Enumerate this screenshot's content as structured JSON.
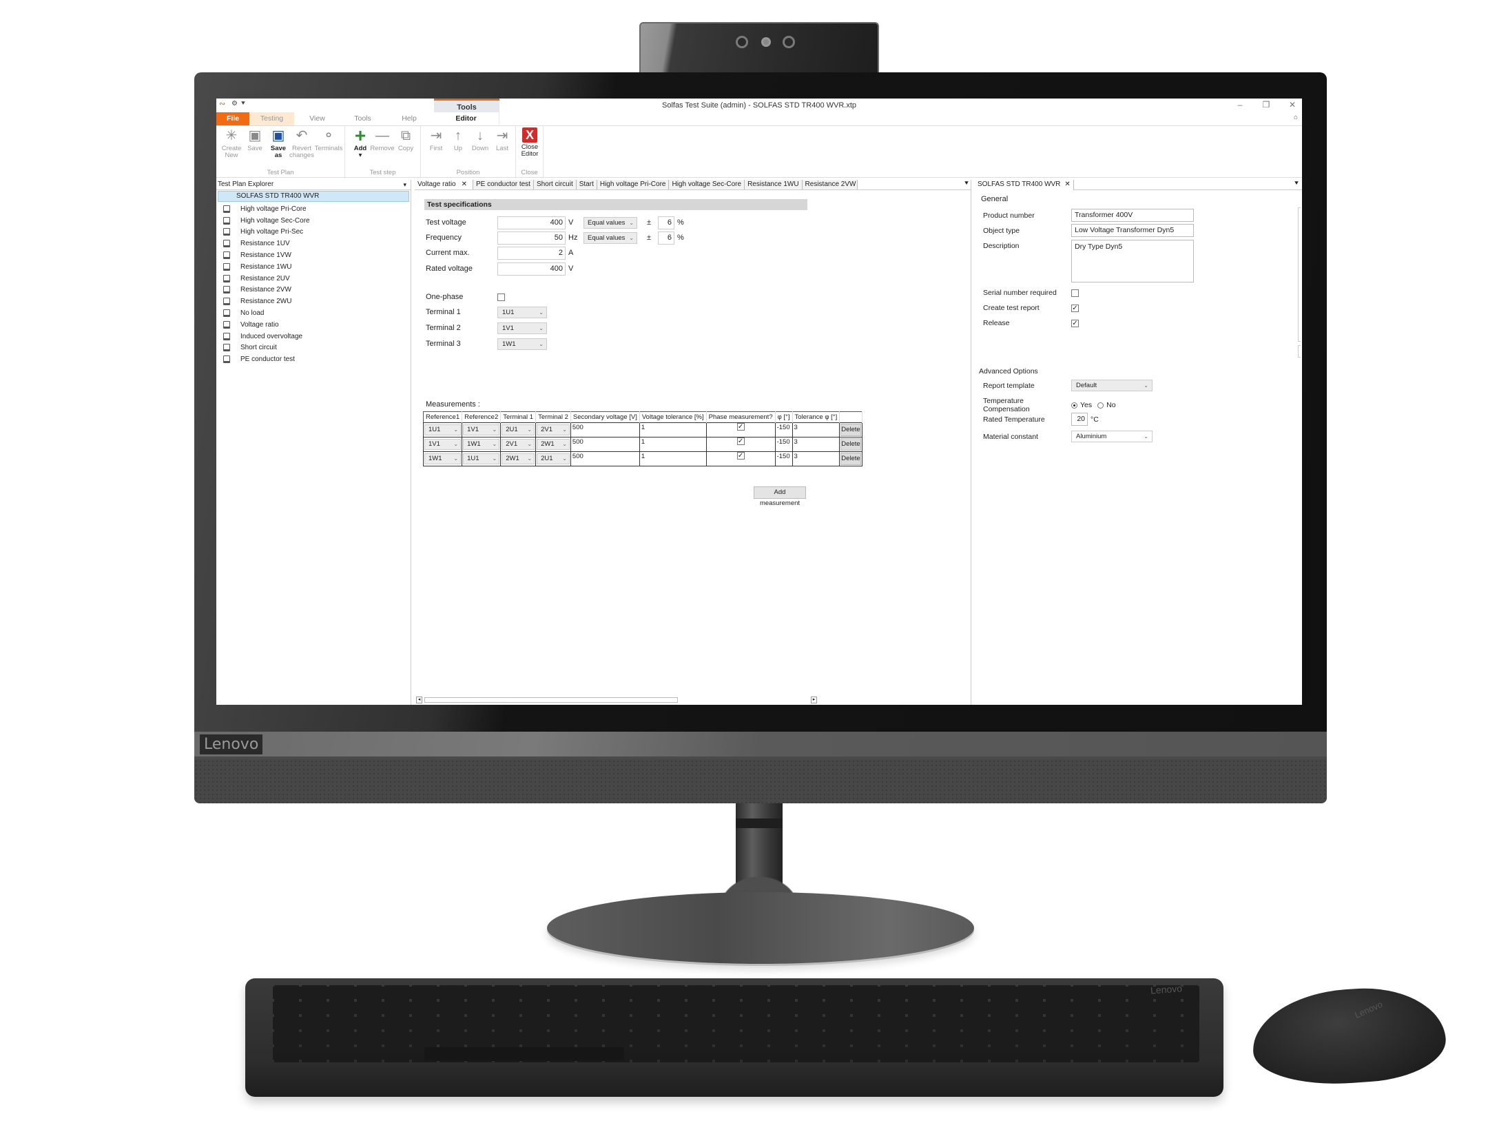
{
  "app": {
    "title": "Solfas Test Suite (admin)  - SOLFAS STD TR400 WVR.xtp",
    "accent_color": "#f26b12",
    "window_controls": {
      "minimize": "–",
      "restore": "❐",
      "close": "✕"
    },
    "collapse_ribbon": "⌂"
  },
  "ribbon": {
    "contextual_group": "Tools",
    "tabs": [
      {
        "label": "File"
      },
      {
        "label": "Testing"
      },
      {
        "label": "View"
      },
      {
        "label": "Tools"
      },
      {
        "label": "Help"
      },
      {
        "label": "Editor"
      }
    ],
    "groups": {
      "test_plan": {
        "label": "Test Plan",
        "buttons": [
          {
            "label": "Create",
            "label2": "New",
            "icon": "✳"
          },
          {
            "label": "Save",
            "label2": "",
            "icon": "💾"
          },
          {
            "label": "Save",
            "label2": "as",
            "icon": "🖉"
          },
          {
            "label": "Revert",
            "label2": "changes",
            "icon": "↶"
          },
          {
            "label": "Terminals",
            "label2": "",
            "icon": "⚲"
          }
        ]
      },
      "test_step": {
        "label": "Test step",
        "buttons": [
          {
            "label": "Add",
            "label2": "▾",
            "icon": "+"
          },
          {
            "label": "Remove",
            "label2": "",
            "icon": "—"
          },
          {
            "label": "Copy",
            "label2": "",
            "icon": "⧉"
          }
        ]
      },
      "position": {
        "label": "Position",
        "buttons": [
          {
            "label": "First",
            "icon": "⇥"
          },
          {
            "label": "Up",
            "icon": "↑"
          },
          {
            "label": "Down",
            "icon": "↓"
          },
          {
            "label": "Last",
            "icon": "⇥"
          }
        ]
      },
      "close": {
        "label": "Close",
        "buttons": [
          {
            "label": "Close",
            "label2": "Editor",
            "icon": "X"
          }
        ]
      }
    }
  },
  "explorer": {
    "title": "Test Plan Explorer",
    "dropdown": "▾",
    "root": "SOLFAS STD TR400 WVR",
    "items": [
      "High voltage Pri-Core",
      "High voltage Sec-Core",
      "High voltage Pri-Sec",
      "Resistance 1UV",
      "Resistance 1VW",
      "Resistance 1WU",
      "Resistance 2UV",
      "Resistance 2VW",
      "Resistance 2WU",
      "No load",
      "Voltage ratio",
      "Induced overvoltage",
      "Short circuit",
      "PE conductor test"
    ]
  },
  "editor": {
    "tabs": [
      {
        "label": "Voltage ratio",
        "close": "✕"
      },
      {
        "label": "PE conductor test"
      },
      {
        "label": "Short circuit"
      },
      {
        "label": "Start"
      },
      {
        "label": "High voltage Pri-Core"
      },
      {
        "label": "High voltage Sec-Core"
      },
      {
        "label": "Resistance 1WU"
      },
      {
        "label": "Resistance 2VW"
      }
    ],
    "tabs_overflow": "⯆",
    "section_title": "Test specifications",
    "fields": {
      "test_voltage": {
        "label": "Test voltage",
        "value": "400",
        "unit": "V",
        "mode": "Equal values",
        "pm": "±",
        "tolerance": "6",
        "tol_unit": "%"
      },
      "frequency": {
        "label": "Frequency",
        "value": "50",
        "unit": "Hz",
        "mode": "Equal values",
        "pm": "±",
        "tolerance": "6",
        "tol_unit": "%"
      },
      "current_max": {
        "label": "Current max.",
        "value": "2",
        "unit": "A"
      },
      "rated_voltage": {
        "label": "Rated voltage",
        "value": "400",
        "unit": "V"
      },
      "one_phase": {
        "label": "One-phase",
        "checked": false
      },
      "terminal1": {
        "label": "Terminal 1",
        "value": "1U1"
      },
      "terminal2": {
        "label": "Terminal 2",
        "value": "1V1"
      },
      "terminal3": {
        "label": "Terminal 3",
        "value": "1W1"
      }
    },
    "measurements": {
      "label": "Measurements  :",
      "columns": [
        "Reference1",
        "Reference2",
        "Terminal 1",
        "Terminal 2",
        "Secondary voltage [V]",
        "Voltage tolerance [%]",
        "Phase measurement?",
        "φ [°]",
        "Tolerance φ [°]",
        ""
      ],
      "rows": [
        {
          "ref1": "1U1",
          "ref2": "1V1",
          "t1": "2U1",
          "t2": "2V1",
          "sec_voltage": "500",
          "v_tol": "1",
          "phase": true,
          "phi": "-150",
          "phi_tol": "3",
          "action": "Delete"
        },
        {
          "ref1": "1V1",
          "ref2": "1W1",
          "t1": "2V1",
          "t2": "2W1",
          "sec_voltage": "500",
          "v_tol": "1",
          "phase": true,
          "phi": "-150",
          "phi_tol": "3",
          "action": "Delete"
        },
        {
          "ref1": "1W1",
          "ref2": "1U1",
          "t1": "2W1",
          "t2": "2U1",
          "sec_voltage": "500",
          "v_tol": "1",
          "phase": true,
          "phi": "-150",
          "phi_tol": "3",
          "action": "Delete"
        }
      ],
      "add_button": "Add measurement"
    },
    "scroll": {
      "left": "◂",
      "right": "▸"
    }
  },
  "properties": {
    "tab": {
      "label": "SOLFAS STD TR400 WVR",
      "close": "✕"
    },
    "overflow": "⯆",
    "general": {
      "title": "General",
      "product_number": {
        "label": "Product number",
        "value": "Transformer 400V"
      },
      "object_type": {
        "label": "Object type",
        "value": "Low Voltage Transformer Dyn5"
      },
      "description": {
        "label": "Description",
        "value": "Dry Type Dyn5"
      },
      "serial_required": {
        "label": "Serial number required",
        "checked": false
      },
      "create_report": {
        "label": "Create test report",
        "checked": true
      },
      "release": {
        "label": "Release",
        "checked": true
      }
    },
    "advanced": {
      "title": "Advanced Options",
      "report_template": {
        "label": "Report template",
        "value": "Default"
      },
      "temp_comp": {
        "label": "Temperature Compensation",
        "options": [
          "Yes",
          "No"
        ],
        "selected": "Yes"
      },
      "rated_temp": {
        "label": "Rated Temperature",
        "value": "20",
        "unit": "°C"
      },
      "material": {
        "label": "Material constant",
        "value": "Aluminium"
      }
    }
  },
  "hardware": {
    "monitor_brand": "Lenovo",
    "keyboard_brand": "Lenovo",
    "mouse_brand": "Lenovo"
  },
  "glyphs": {
    "chevron": "⌄",
    "check": "✓"
  }
}
